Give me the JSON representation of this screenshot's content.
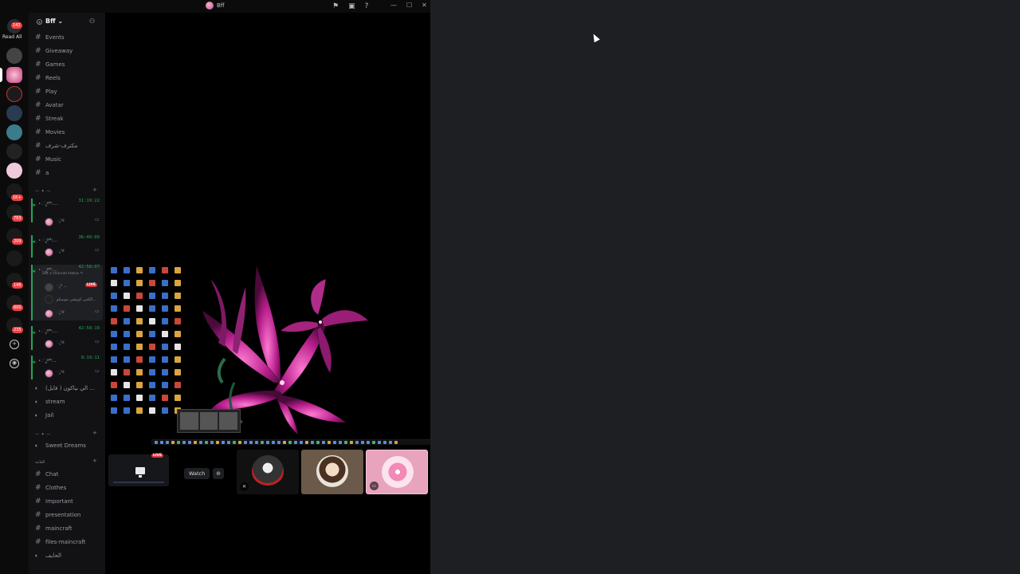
{
  "window": {
    "title": "Bff",
    "icons": [
      "flag-icon",
      "screen-share-icon",
      "help-icon"
    ],
    "controls": [
      "minimize",
      "maximize",
      "close"
    ]
  },
  "rail": {
    "home_badge": "142",
    "read_all": "Read All",
    "badges": [
      "1K+",
      "783",
      "209",
      "146",
      "600",
      "235"
    ]
  },
  "server": {
    "name": "Bff"
  },
  "channels": [
    {
      "type": "text",
      "label": "Events"
    },
    {
      "type": "text",
      "label": "Giveaway"
    },
    {
      "type": "text",
      "label": "Games"
    },
    {
      "type": "text",
      "label": "Reels"
    },
    {
      "type": "text",
      "label": "Play"
    },
    {
      "type": "text",
      "label": "Avatar"
    },
    {
      "type": "text",
      "label": "Streak"
    },
    {
      "type": "text",
      "label": "Movies"
    },
    {
      "type": "text",
      "label": "مكترف-شرف"
    },
    {
      "type": "text",
      "label": "Music"
    },
    {
      "type": "text",
      "label": "a"
    }
  ],
  "category1": {
    "label": "— ✦ —"
  },
  "voice_channels": [
    {
      "name": "⋆.ೃ࿔*:...",
      "timer": "31:19:22",
      "member": "ೃ༄"
    },
    {
      "name": "⋆.ೃ࿔*:...",
      "timer": "36:40:09",
      "member": "ೃ༄"
    },
    {
      "name": "⋆.ೃ࿔*:...",
      "timer": "42:58:07",
      "status": "Set a channel status ✎",
      "members": [
        {
          "name": "ೃ࿔ ...",
          "live": "LIVE"
        },
        {
          "name": "الكس كوتشي موسكو..."
        },
        {
          "name": "ೃ༄"
        }
      ]
    },
    {
      "name": "⋆.ೃ࿔*:...",
      "timer": "42:58:19",
      "member": "ೃ༄"
    },
    {
      "name": "⋆.ೃ࿔*:..",
      "timer": "8:19:11",
      "member": "ೃ༄"
    }
  ],
  "voice_plain": [
    {
      "label": "(فايل ) الي بياكون ..."
    },
    {
      "label": "stream"
    },
    {
      "label": "Jail"
    }
  ],
  "category2": {
    "label": "— ✦ —"
  },
  "sweet_dreams": {
    "label": "Sweet Dreams"
  },
  "category3": {
    "label": "العامة"
  },
  "text2": [
    {
      "type": "text",
      "label": "Chat"
    },
    {
      "type": "text",
      "label": "Clothes"
    },
    {
      "type": "text",
      "label": "Important"
    },
    {
      "type": "text",
      "label": "presentation"
    },
    {
      "type": "text",
      "label": "maincraft"
    },
    {
      "type": "text",
      "label": "files-maincraft"
    },
    {
      "type": "voice",
      "label": "الحايف"
    }
  ],
  "stage": {
    "live_label": "LIVE",
    "watch_label": "Watch",
    "tile_colors": [
      "#111111",
      "#6b5a49",
      "#e8a3bd"
    ]
  }
}
